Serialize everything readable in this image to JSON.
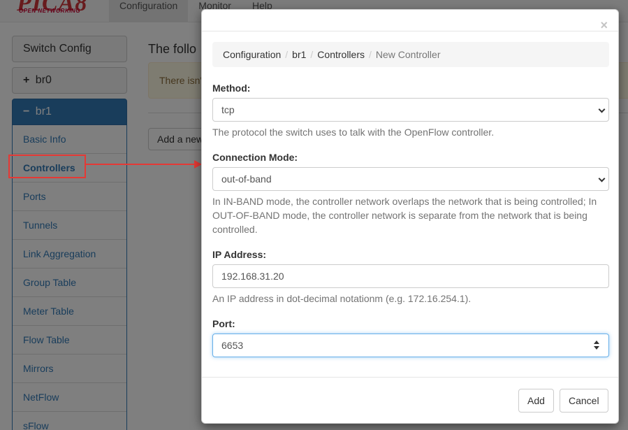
{
  "app": {
    "logo_text": "PICA8",
    "logo_subtext": "OPEN NETWORKING",
    "nav": [
      "Configuration",
      "Monitor",
      "Help"
    ]
  },
  "sidebar": {
    "switch_config": "Switch Config",
    "bridges": [
      {
        "symbol": "+",
        "label": "br0"
      },
      {
        "symbol": "−",
        "label": "br1"
      }
    ],
    "items": [
      "Basic Info",
      "Controllers",
      "Ports",
      "Tunnels",
      "Link Aggregation",
      "Group Table",
      "Meter Table",
      "Flow Table",
      "Mirrors",
      "NetFlow",
      "sFlow"
    ]
  },
  "main": {
    "title": "The follo",
    "alert": "There isn'",
    "add_button": "Add a new"
  },
  "modal": {
    "close": "×",
    "breadcrumb": [
      "Configuration",
      "br1",
      "Controllers",
      "New Controller"
    ],
    "method": {
      "label": "Method:",
      "value": "tcp",
      "help": "The protocol the switch uses to talk with the OpenFlow controller."
    },
    "connection_mode": {
      "label": "Connection Mode:",
      "value": "out-of-band",
      "help": "In IN-BAND mode, the controller network overlaps the network that is being controlled; In OUT-OF-BAND mode, the controller network is separate from the network that is being controlled."
    },
    "ip_address": {
      "label": "IP Address:",
      "value": "192.168.31.20",
      "help": "An IP address in dot-decimal notationm (e.g. 172.16.254.1)."
    },
    "port": {
      "label": "Port:",
      "value": "6653"
    },
    "buttons": {
      "add": "Add",
      "cancel": "Cancel"
    }
  },
  "colors": {
    "annotation": "#e53935",
    "primary": "#337ab7"
  }
}
